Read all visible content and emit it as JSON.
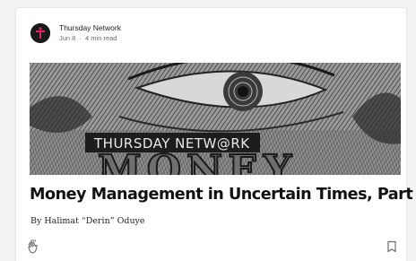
{
  "publication": {
    "name": "Thursday Network",
    "date": "Jun 8",
    "separator": "·",
    "read_time": "4 min read",
    "avatar_icon": "thursday-network-logo-icon"
  },
  "hero": {
    "banner_text": "THURSDAY NETW@RK",
    "money_text": "MONEY",
    "brand_color": "#1d1d1d"
  },
  "article": {
    "title": "Money Management in Uncertain Times, Part II",
    "byline": "By Halimat “Derin” Oduye"
  },
  "actions": {
    "clap_icon": "clap-icon",
    "bookmark_icon": "bookmark-icon"
  }
}
